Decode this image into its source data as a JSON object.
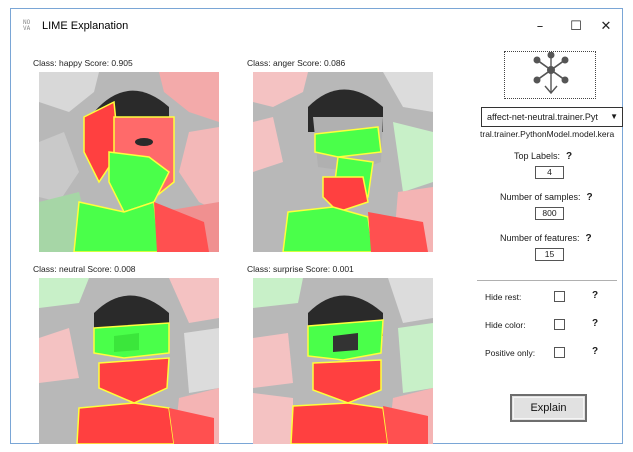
{
  "window": {
    "title": "LIME Explanation",
    "icon_text": "NO\nVA",
    "minimize_glyph": "–",
    "maximize_glyph": "☐",
    "close_glyph": "✕"
  },
  "panels": [
    {
      "label": "Class: happy Score: 0.905"
    },
    {
      "label": "Class: anger Score: 0.086"
    },
    {
      "label": "Class: neutral Score: 0.008"
    },
    {
      "label": "Class: surprise Score: 0.001"
    }
  ],
  "sidebar": {
    "network_icon": "neural-network-download-icon",
    "model_select_value": "affect-net-neutral.trainer.Pyt",
    "select_arrow": "▼",
    "model_path": "tral.trainer.PythonModel.model.kera",
    "top_labels": {
      "label": "Top Labels:",
      "value": "4",
      "help": "?"
    },
    "num_samples": {
      "label": "Number of samples:",
      "value": "800",
      "help": "?"
    },
    "num_features": {
      "label": "Number of features:",
      "value": "15",
      "help": "?"
    },
    "hide_rest": {
      "label": "Hide rest:",
      "help": "?",
      "checked": false
    },
    "hide_color": {
      "label": "Hide color:",
      "help": "?",
      "checked": false
    },
    "positive_only": {
      "label": "Positive only:",
      "help": "?",
      "checked": false
    },
    "explain_label": "Explain"
  },
  "colors": {
    "positive": "#3cff3c",
    "negative": "#ff3c3c",
    "boundary": "#ffff3c",
    "accent_border": "#7aa6d6"
  }
}
